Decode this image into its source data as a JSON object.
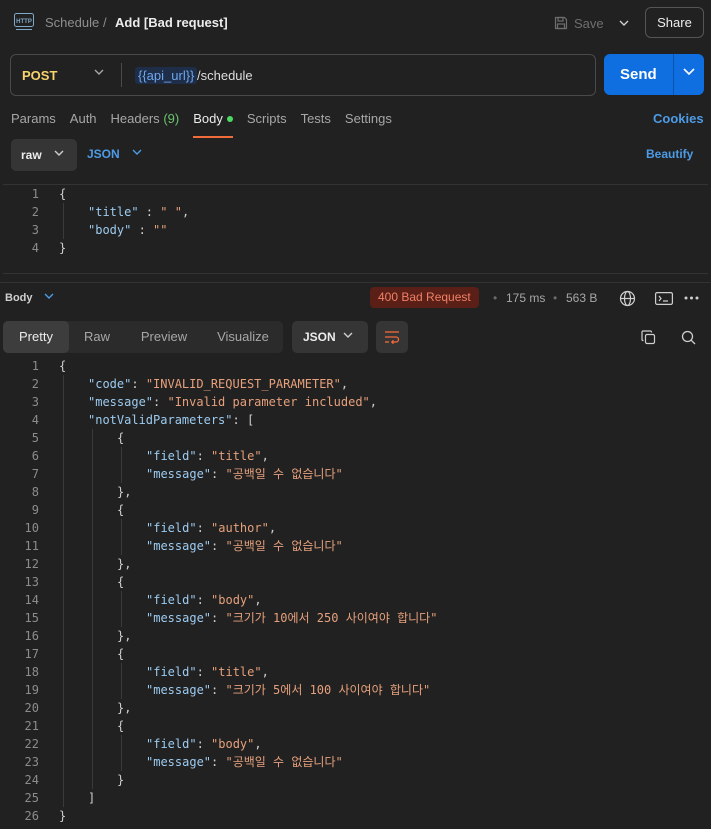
{
  "header": {
    "breadcrumb_parent": "Schedule",
    "breadcrumb_sep": "/",
    "title": "Add [Bad request]",
    "save_label": "Save",
    "share_label": "Share"
  },
  "request": {
    "method": "POST",
    "url_variable": "{{api_url}}",
    "url_path": "/schedule",
    "send_label": "Send"
  },
  "tabs": [
    {
      "label": "Params"
    },
    {
      "label": "Auth"
    },
    {
      "label": "Headers",
      "count": "(9)"
    },
    {
      "label": "Body",
      "active": true
    },
    {
      "label": "Scripts"
    },
    {
      "label": "Tests"
    },
    {
      "label": "Settings"
    }
  ],
  "cookies_label": "Cookies",
  "body_options": {
    "mode": "raw",
    "language": "JSON",
    "beautify_label": "Beautify"
  },
  "request_body_lines": [
    {
      "n": "1",
      "indent": 0,
      "parts": [
        [
          "p",
          "{"
        ]
      ]
    },
    {
      "n": "2",
      "indent": 1,
      "parts": [
        [
          "k",
          "\"title\""
        ],
        [
          "p",
          " : "
        ],
        [
          "s",
          "\" \""
        ],
        [
          "p",
          ","
        ]
      ]
    },
    {
      "n": "3",
      "indent": 1,
      "parts": [
        [
          "k",
          "\"body\""
        ],
        [
          "p",
          " : "
        ],
        [
          "s",
          "\"\""
        ]
      ]
    },
    {
      "n": "4",
      "indent": 0,
      "parts": [
        [
          "p",
          "}"
        ]
      ]
    }
  ],
  "response": {
    "section_label": "Body",
    "status": "400 Bad Request",
    "time": "175 ms",
    "size": "563 B",
    "view_tabs": [
      "Pretty",
      "Raw",
      "Preview",
      "Visualize"
    ],
    "active_view": "Pretty",
    "format": "JSON"
  },
  "response_lines": [
    {
      "n": "1",
      "indent": 0,
      "parts": [
        [
          "p",
          "{"
        ]
      ]
    },
    {
      "n": "2",
      "indent": 1,
      "parts": [
        [
          "k",
          "\"code\""
        ],
        [
          "p",
          ": "
        ],
        [
          "s",
          "\"INVALID_REQUEST_PARAMETER\""
        ],
        [
          "p",
          ","
        ]
      ]
    },
    {
      "n": "3",
      "indent": 1,
      "parts": [
        [
          "k",
          "\"message\""
        ],
        [
          "p",
          ": "
        ],
        [
          "s",
          "\"Invalid parameter included\""
        ],
        [
          "p",
          ","
        ]
      ]
    },
    {
      "n": "4",
      "indent": 1,
      "parts": [
        [
          "k",
          "\"notValidParameters\""
        ],
        [
          "p",
          ": ["
        ]
      ]
    },
    {
      "n": "5",
      "indent": 2,
      "parts": [
        [
          "p",
          "{"
        ]
      ]
    },
    {
      "n": "6",
      "indent": 3,
      "parts": [
        [
          "k",
          "\"field\""
        ],
        [
          "p",
          ": "
        ],
        [
          "s",
          "\"title\""
        ],
        [
          "p",
          ","
        ]
      ]
    },
    {
      "n": "7",
      "indent": 3,
      "parts": [
        [
          "k",
          "\"message\""
        ],
        [
          "p",
          ": "
        ],
        [
          "s",
          "\"공백일 수 없습니다\""
        ]
      ]
    },
    {
      "n": "8",
      "indent": 2,
      "parts": [
        [
          "p",
          "},"
        ]
      ]
    },
    {
      "n": "9",
      "indent": 2,
      "parts": [
        [
          "p",
          "{"
        ]
      ]
    },
    {
      "n": "10",
      "indent": 3,
      "parts": [
        [
          "k",
          "\"field\""
        ],
        [
          "p",
          ": "
        ],
        [
          "s",
          "\"author\""
        ],
        [
          "p",
          ","
        ]
      ]
    },
    {
      "n": "11",
      "indent": 3,
      "parts": [
        [
          "k",
          "\"message\""
        ],
        [
          "p",
          ": "
        ],
        [
          "s",
          "\"공백일 수 없습니다\""
        ]
      ]
    },
    {
      "n": "12",
      "indent": 2,
      "parts": [
        [
          "p",
          "},"
        ]
      ]
    },
    {
      "n": "13",
      "indent": 2,
      "parts": [
        [
          "p",
          "{"
        ]
      ]
    },
    {
      "n": "14",
      "indent": 3,
      "parts": [
        [
          "k",
          "\"field\""
        ],
        [
          "p",
          ": "
        ],
        [
          "s",
          "\"body\""
        ],
        [
          "p",
          ","
        ]
      ]
    },
    {
      "n": "15",
      "indent": 3,
      "parts": [
        [
          "k",
          "\"message\""
        ],
        [
          "p",
          ": "
        ],
        [
          "s",
          "\"크기가 10에서 250 사이여야 합니다\""
        ]
      ]
    },
    {
      "n": "16",
      "indent": 2,
      "parts": [
        [
          "p",
          "},"
        ]
      ]
    },
    {
      "n": "17",
      "indent": 2,
      "parts": [
        [
          "p",
          "{"
        ]
      ]
    },
    {
      "n": "18",
      "indent": 3,
      "parts": [
        [
          "k",
          "\"field\""
        ],
        [
          "p",
          ": "
        ],
        [
          "s",
          "\"title\""
        ],
        [
          "p",
          ","
        ]
      ]
    },
    {
      "n": "19",
      "indent": 3,
      "parts": [
        [
          "k",
          "\"message\""
        ],
        [
          "p",
          ": "
        ],
        [
          "s",
          "\"크기가 5에서 100 사이여야 합니다\""
        ]
      ]
    },
    {
      "n": "20",
      "indent": 2,
      "parts": [
        [
          "p",
          "},"
        ]
      ]
    },
    {
      "n": "21",
      "indent": 2,
      "parts": [
        [
          "p",
          "{"
        ]
      ]
    },
    {
      "n": "22",
      "indent": 3,
      "parts": [
        [
          "k",
          "\"field\""
        ],
        [
          "p",
          ": "
        ],
        [
          "s",
          "\"body\""
        ],
        [
          "p",
          ","
        ]
      ]
    },
    {
      "n": "23",
      "indent": 3,
      "parts": [
        [
          "k",
          "\"message\""
        ],
        [
          "p",
          ": "
        ],
        [
          "s",
          "\"공백일 수 없습니다\""
        ]
      ]
    },
    {
      "n": "24",
      "indent": 2,
      "parts": [
        [
          "p",
          "}"
        ]
      ]
    },
    {
      "n": "25",
      "indent": 1,
      "parts": [
        [
          "p",
          "]"
        ]
      ]
    },
    {
      "n": "26",
      "indent": 0,
      "parts": [
        [
          "p",
          "}"
        ]
      ]
    }
  ],
  "colors": {
    "accent": "#0f6ee0",
    "method": "#f7d36d",
    "status_bg": "#5a1f16",
    "status_text": "#ef8066",
    "active_tab_underline": "#f26b3a",
    "json_key": "#9ccbf0",
    "json_string": "#e6a07c"
  }
}
